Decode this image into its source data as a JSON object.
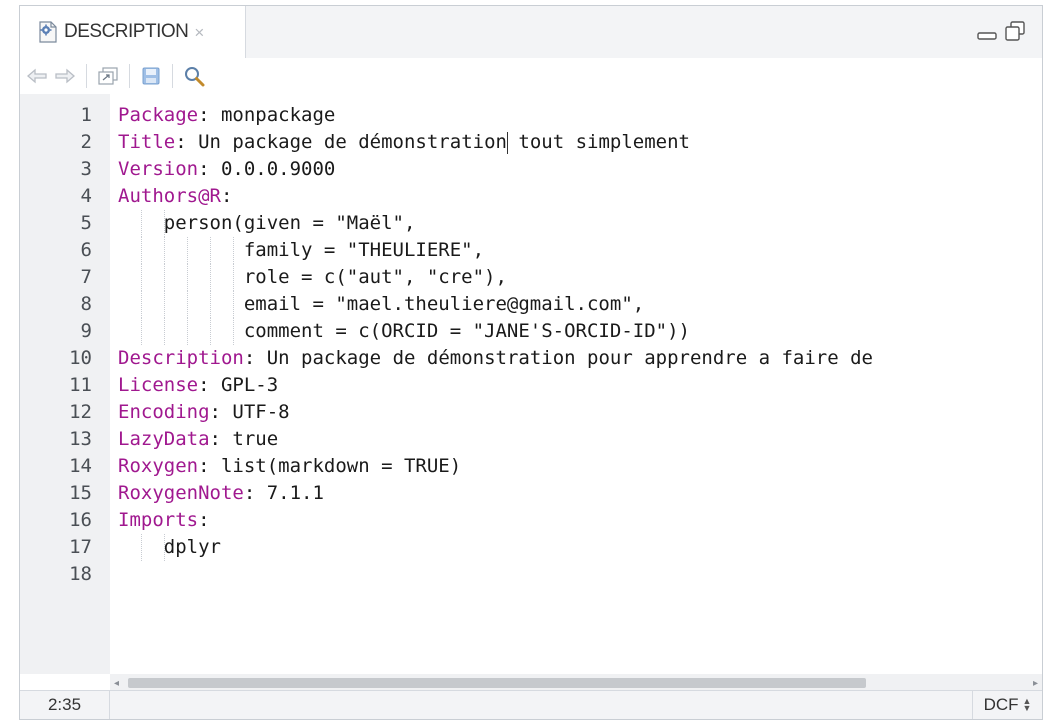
{
  "tab": {
    "title": "DESCRIPTION",
    "close_glyph": "×"
  },
  "toolbar": {
    "icons": [
      "back-arrow-icon",
      "forward-arrow-icon",
      "show-in-window-icon",
      "save-icon",
      "search-icon"
    ]
  },
  "editor": {
    "lines": [
      {
        "num": "1",
        "key": "Package",
        "text": "monpackage"
      },
      {
        "num": "2",
        "key": "Title",
        "text": "Un package de démonstration tout simplement"
      },
      {
        "num": "3",
        "key": "Version",
        "text": "0.0.0.9000"
      },
      {
        "num": "4",
        "key": "Authors@R",
        "text": ""
      },
      {
        "num": "5",
        "key": "",
        "text": "    person(given = \"Maël\","
      },
      {
        "num": "6",
        "key": "",
        "text": "           family = \"THEULIERE\","
      },
      {
        "num": "7",
        "key": "",
        "text": "           role = c(\"aut\", \"cre\"),"
      },
      {
        "num": "8",
        "key": "",
        "text": "           email = \"mael.theuliere@gmail.com\","
      },
      {
        "num": "9",
        "key": "",
        "text": "           comment = c(ORCID = \"JANE'S-ORCID-ID\"))"
      },
      {
        "num": "10",
        "key": "Description",
        "text": "Un package de démonstration pour apprendre a faire de"
      },
      {
        "num": "11",
        "key": "License",
        "text": "GPL-3"
      },
      {
        "num": "12",
        "key": "Encoding",
        "text": "UTF-8"
      },
      {
        "num": "13",
        "key": "LazyData",
        "text": "true"
      },
      {
        "num": "14",
        "key": "Roxygen",
        "text": "list(markdown = TRUE)"
      },
      {
        "num": "15",
        "key": "RoxygenNote",
        "text": "7.1.1"
      },
      {
        "num": "16",
        "key": "Imports",
        "text": ""
      },
      {
        "num": "17",
        "key": "",
        "text": "    dplyr"
      },
      {
        "num": "18",
        "key": "",
        "text": ""
      }
    ]
  },
  "status": {
    "cursor_position": "2:35",
    "file_mode": "DCF"
  },
  "colors": {
    "key": "#a0188f",
    "text": "#1a1a1a",
    "gutter": "#f0f1f3"
  }
}
